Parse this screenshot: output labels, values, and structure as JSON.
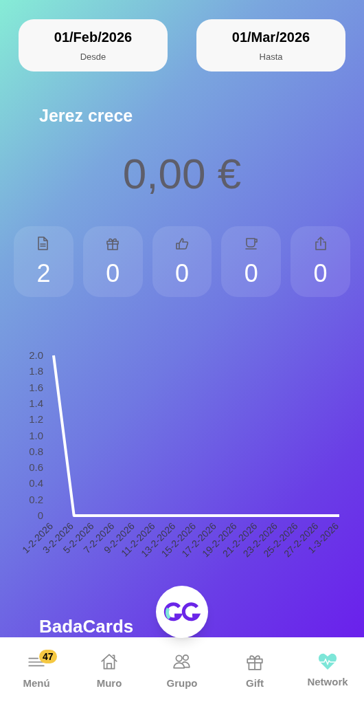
{
  "date_range": [
    {
      "value": "01/Feb/2026",
      "label": "Desde"
    },
    {
      "value": "01/Mar/2026",
      "label": "Hasta"
    }
  ],
  "title": "Jerez crece",
  "amount": "0,00 €",
  "stats": [
    {
      "kind": "document",
      "value": "2"
    },
    {
      "kind": "gift",
      "value": "0"
    },
    {
      "kind": "like",
      "value": "0"
    },
    {
      "kind": "coffee",
      "value": "0"
    },
    {
      "kind": "share",
      "value": "0"
    }
  ],
  "chart_data": {
    "type": "line",
    "categories": [
      "1-2-2026",
      "3-2-2026",
      "5-2-2026",
      "7-2-2026",
      "9-2-2026",
      "11-2-2026",
      "13-2-2026",
      "15-2-2026",
      "17-2-2026",
      "19-2-2026",
      "21-2-2026",
      "23-2-2026",
      "25-2-2026",
      "27-2-2026",
      "1-3-2026"
    ],
    "series": [
      {
        "color": "#ffffff",
        "values": [
          2,
          0,
          0,
          0,
          0,
          0,
          0,
          0,
          0,
          0,
          0,
          0,
          0,
          0,
          0
        ]
      }
    ],
    "yticks": [
      {
        "value": 0,
        "label": "0"
      },
      {
        "value": 0.2,
        "label": "0.2"
      },
      {
        "value": 0.4,
        "label": "0.4"
      },
      {
        "value": 0.6,
        "label": "0.6"
      },
      {
        "value": 0.8,
        "label": "0.8"
      },
      {
        "value": 1,
        "label": "1.0"
      },
      {
        "value": 1.2,
        "label": "1.2"
      },
      {
        "value": 1.4,
        "label": "1.4"
      },
      {
        "value": 1.6,
        "label": "1.6"
      },
      {
        "value": 1.8,
        "label": "1.8"
      },
      {
        "value": 2,
        "label": "2.0"
      }
    ],
    "ylim": [
      0,
      2
    ]
  },
  "section_title": "BadaCards",
  "nav": [
    {
      "kind": "menu",
      "label": "Menú",
      "badge": "47",
      "selected": false
    },
    {
      "kind": "home",
      "label": "Muro",
      "selected": false
    },
    {
      "kind": "group",
      "label": "Grupo",
      "selected": false
    },
    {
      "kind": "gift",
      "label": "Gift",
      "selected": false
    },
    {
      "kind": "network",
      "label": "Network",
      "selected": true
    }
  ]
}
